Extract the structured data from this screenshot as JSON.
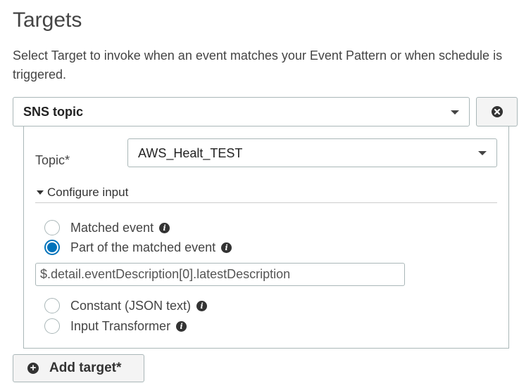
{
  "header": {
    "title": "Targets",
    "description": "Select Target to invoke when an event matches your Event Pattern or when schedule is triggered."
  },
  "target": {
    "type_selected": "SNS topic",
    "remove_icon": "close-circle-icon",
    "topic_label": "Topic*",
    "topic_value": "AWS_Healt_TEST",
    "configure_input_label": "Configure input",
    "options": [
      {
        "label": "Matched event",
        "checked": false
      },
      {
        "label": "Part of the matched event",
        "checked": true
      },
      {
        "label": "Constant (JSON text)",
        "checked": false
      },
      {
        "label": "Input Transformer",
        "checked": false
      }
    ],
    "path_value": "$.detail.eventDescription[0].latestDescription"
  },
  "footer": {
    "add_target_label": "Add target*"
  },
  "colors": {
    "accent": "#0073bb",
    "border": "#aab7b8",
    "button_bg": "#f4f4f4"
  }
}
